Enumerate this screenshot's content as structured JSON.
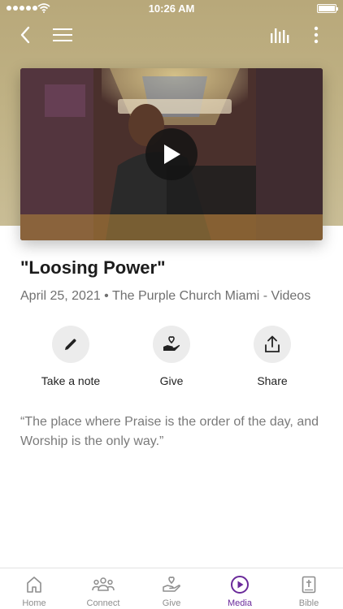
{
  "status_bar": {
    "time": "10:26 AM",
    "signal_icon": "signal-dots-icon",
    "wifi_icon": "wifi-icon",
    "battery_icon": "battery-icon"
  },
  "topnav": {
    "back_icon": "chevron-left-icon",
    "menu_icon": "hamburger-menu-icon",
    "audio_icon": "audio-bars-icon",
    "more_icon": "vertical-dots-icon"
  },
  "video": {
    "play_icon": "play-icon"
  },
  "content": {
    "title": "\"Loosing Power\"",
    "meta": "April 25, 2021 • The Purple Church Miami - Videos",
    "quote": "“The place where Praise is the order of the day, and Worship is the only way.”"
  },
  "actions": [
    {
      "label": "Take a note",
      "icon": "pencil-icon"
    },
    {
      "label": "Give",
      "icon": "heart-hand-icon"
    },
    {
      "label": "Share",
      "icon": "share-upload-icon"
    }
  ],
  "tabs": [
    {
      "label": "Home",
      "icon": "home-icon"
    },
    {
      "label": "Connect",
      "icon": "people-group-icon"
    },
    {
      "label": "Give",
      "icon": "heart-hand-icon"
    },
    {
      "label": "Media",
      "icon": "play-circle-icon",
      "active": true
    },
    {
      "label": "Bible",
      "icon": "bible-cross-icon"
    }
  ],
  "colors": {
    "accent": "#6a2a9a",
    "hero_bg": "#bfb184",
    "inactive_tab": "#8e8e8e"
  }
}
